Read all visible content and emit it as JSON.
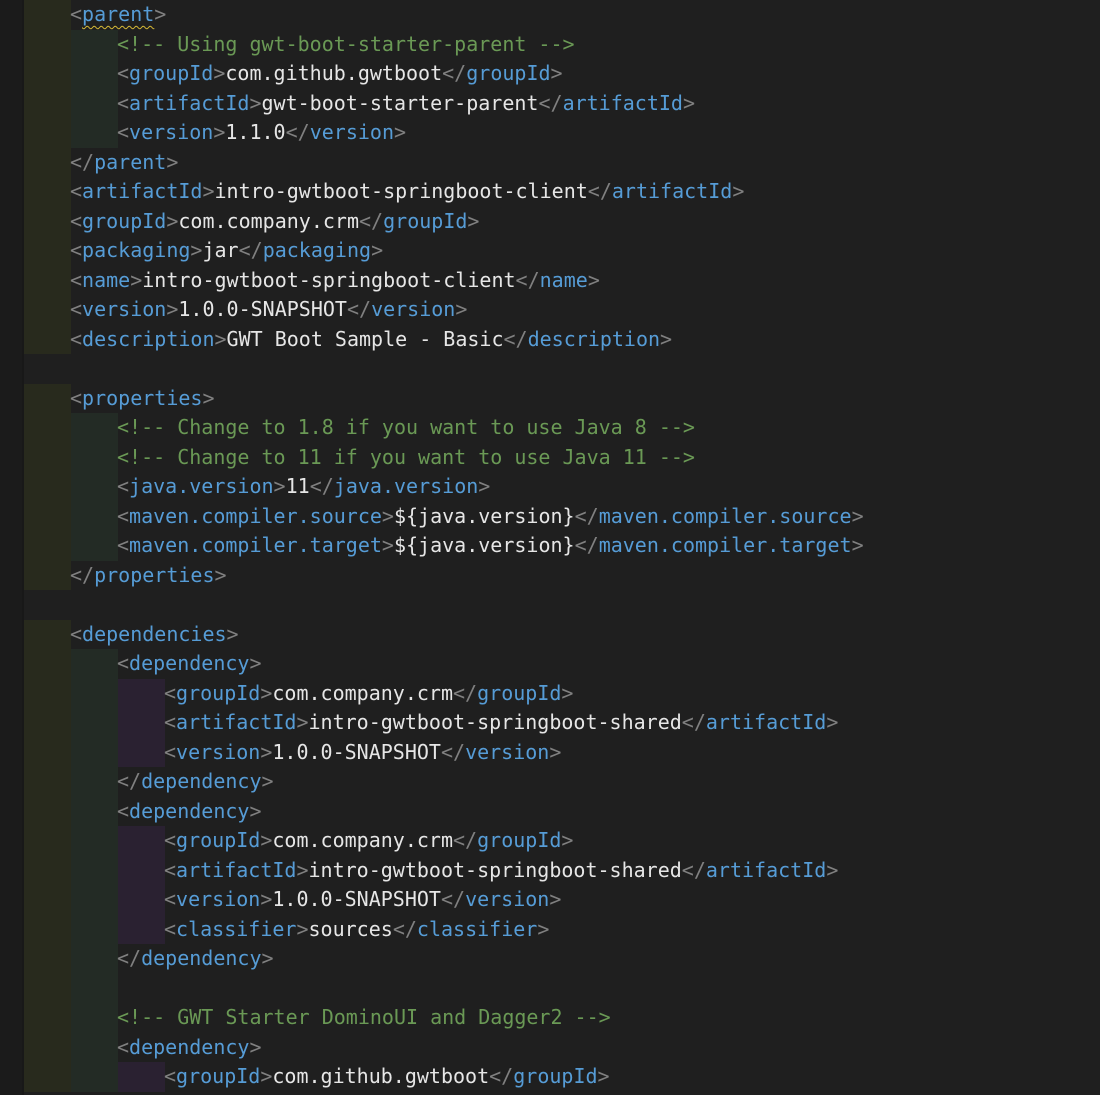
{
  "colors": {
    "background": "#1f1f1f",
    "bracket": "#808080",
    "tag": "#569cd6",
    "text": "#e6e6e6",
    "comment": "#6a9955",
    "indent_guide_1": "#282a1d",
    "indent_guide_2": "#232b25",
    "indent_guide_3": "#2a2131",
    "squiggle": "#d7ba36"
  },
  "lines": [
    {
      "indent": 1,
      "open": "parent",
      "squiggle": true
    },
    {
      "indent": 2,
      "comment": "<!-- Using gwt-boot-starter-parent -->"
    },
    {
      "indent": 2,
      "open": "groupId",
      "text": "com.github.gwtboot",
      "close": "groupId"
    },
    {
      "indent": 2,
      "open": "artifactId",
      "text": "gwt-boot-starter-parent",
      "close": "artifactId"
    },
    {
      "indent": 2,
      "open": "version",
      "text": "1.1.0",
      "close": "version"
    },
    {
      "indent": 1,
      "close": "parent"
    },
    {
      "indent": 1,
      "open": "artifactId",
      "text": "intro-gwtboot-springboot-client",
      "close": "artifactId"
    },
    {
      "indent": 1,
      "open": "groupId",
      "text": "com.company.crm",
      "close": "groupId"
    },
    {
      "indent": 1,
      "open": "packaging",
      "text": "jar",
      "close": "packaging"
    },
    {
      "indent": 1,
      "open": "name",
      "text": "intro-gwtboot-springboot-client",
      "close": "name"
    },
    {
      "indent": 1,
      "open": "version",
      "text": "1.0.0-SNAPSHOT",
      "close": "version"
    },
    {
      "indent": 1,
      "open": "description",
      "text": "GWT Boot Sample - Basic",
      "close": "description"
    },
    {
      "indent": 0,
      "blank": true
    },
    {
      "indent": 1,
      "open": "properties"
    },
    {
      "indent": 2,
      "comment": "<!-- Change to 1.8 if you want to use Java 8 -->"
    },
    {
      "indent": 2,
      "comment": "<!-- Change to 11 if you want to use Java 11 -->"
    },
    {
      "indent": 2,
      "open": "java.version",
      "text": "11",
      "close": "java.version"
    },
    {
      "indent": 2,
      "open": "maven.compiler.source",
      "text": "${java.version}",
      "close": "maven.compiler.source"
    },
    {
      "indent": 2,
      "open": "maven.compiler.target",
      "text": "${java.version}",
      "close": "maven.compiler.target"
    },
    {
      "indent": 1,
      "close": "properties"
    },
    {
      "indent": 0,
      "blank": true
    },
    {
      "indent": 1,
      "open": "dependencies"
    },
    {
      "indent": 2,
      "open": "dependency"
    },
    {
      "indent": 3,
      "open": "groupId",
      "text": "com.company.crm",
      "close": "groupId"
    },
    {
      "indent": 3,
      "open": "artifactId",
      "text": "intro-gwtboot-springboot-shared",
      "close": "artifactId"
    },
    {
      "indent": 3,
      "open": "version",
      "text": "1.0.0-SNAPSHOT",
      "close": "version"
    },
    {
      "indent": 2,
      "close": "dependency"
    },
    {
      "indent": 2,
      "open": "dependency"
    },
    {
      "indent": 3,
      "open": "groupId",
      "text": "com.company.crm",
      "close": "groupId"
    },
    {
      "indent": 3,
      "open": "artifactId",
      "text": "intro-gwtboot-springboot-shared",
      "close": "artifactId"
    },
    {
      "indent": 3,
      "open": "version",
      "text": "1.0.0-SNAPSHOT",
      "close": "version"
    },
    {
      "indent": 3,
      "open": "classifier",
      "text": "sources",
      "close": "classifier"
    },
    {
      "indent": 2,
      "close": "dependency"
    },
    {
      "indent": 2,
      "blank": true
    },
    {
      "indent": 2,
      "comment": "<!-- GWT Starter DominoUI and Dagger2 -->"
    },
    {
      "indent": 2,
      "open": "dependency"
    },
    {
      "indent": 3,
      "open": "groupId",
      "text": "com.github.gwtboot",
      "close": "groupId"
    }
  ]
}
